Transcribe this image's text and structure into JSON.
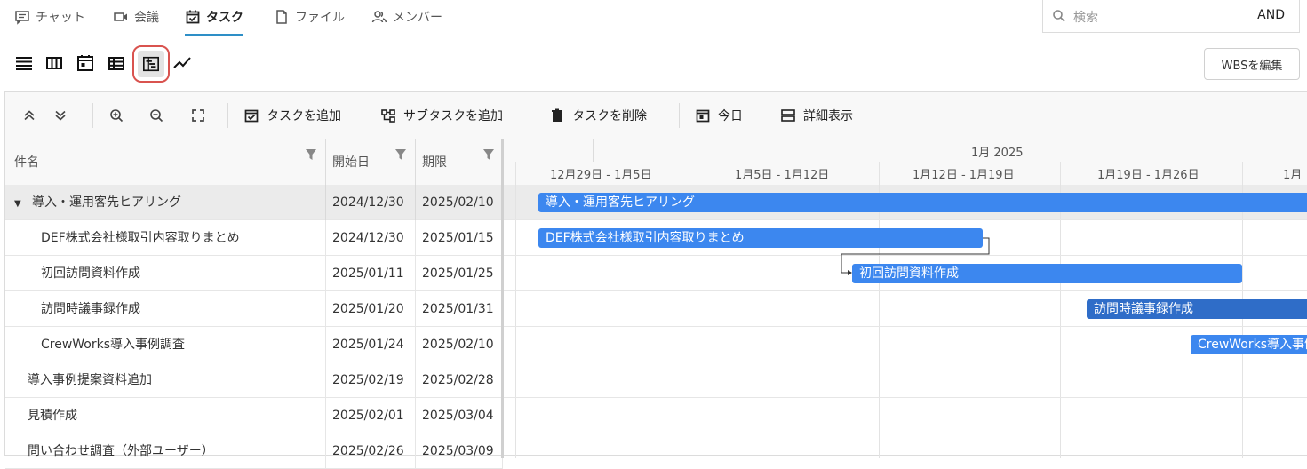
{
  "nav": {
    "tabs": [
      {
        "label": "チャット"
      },
      {
        "label": "会議"
      },
      {
        "label": "タスク"
      },
      {
        "label": "ファイル"
      },
      {
        "label": "メンバー"
      }
    ],
    "search_placeholder": "検索",
    "search_mode": "AND"
  },
  "views": [
    "list-view-icon",
    "board-view-icon",
    "calendar-view-icon",
    "table-view-icon",
    "gantt-view-icon",
    "chart-view-icon"
  ],
  "selected_view": "gantt-view-icon",
  "wbs_button": "WBSを編集",
  "toolbar": {
    "add_task": "タスクを追加",
    "add_subtask": "サブタスクを追加",
    "delete_task": "タスクを削除",
    "today": "今日",
    "detail": "詳細表示"
  },
  "columns": {
    "name": "件名",
    "start": "開始日",
    "due": "期限"
  },
  "timeline": {
    "month": "1月 2025",
    "weeks": [
      "12月29日 - 1月5日",
      "1月5日 - 1月12日",
      "1月12日 - 1月19日",
      "1月19日 - 1月26日",
      "1月"
    ]
  },
  "tasks": [
    {
      "name": "導入・運用客先ヒアリング",
      "start": "2024/12/30",
      "due": "2025/02/10",
      "group": true
    },
    {
      "name": "DEF株式会社様取引内容取りまとめ",
      "start": "2024/12/30",
      "due": "2025/01/15"
    },
    {
      "name": "初回訪問資料作成",
      "start": "2025/01/11",
      "due": "2025/01/25"
    },
    {
      "name": "訪問時議事録作成",
      "start": "2025/01/20",
      "due": "2025/01/31"
    },
    {
      "name": "CrewWorks導入事例調査",
      "start": "2025/01/24",
      "due": "2025/02/10"
    },
    {
      "name": "導入事例提案資料追加",
      "start": "2025/02/19",
      "due": "2025/02/28"
    },
    {
      "name": "見積作成",
      "start": "2025/02/01",
      "due": "2025/03/04"
    },
    {
      "name": "問い合わせ調査（外部ユーザー）",
      "start": "2025/02/26",
      "due": "2025/03/09"
    }
  ],
  "bars": [
    {
      "label": "導入・運用客先ヒアリング"
    },
    {
      "label": "DEF株式会社様取引内容取りまとめ"
    },
    {
      "label": "初回訪問資料作成"
    },
    {
      "label": "訪問時議事録作成"
    },
    {
      "label": "CrewWorks導入事例調査"
    }
  ],
  "colors": {
    "accent": "#2e8fc7",
    "bar": "#3c87ef",
    "bar_selected": "#2f6dc8",
    "highlight": "#d9534f"
  }
}
